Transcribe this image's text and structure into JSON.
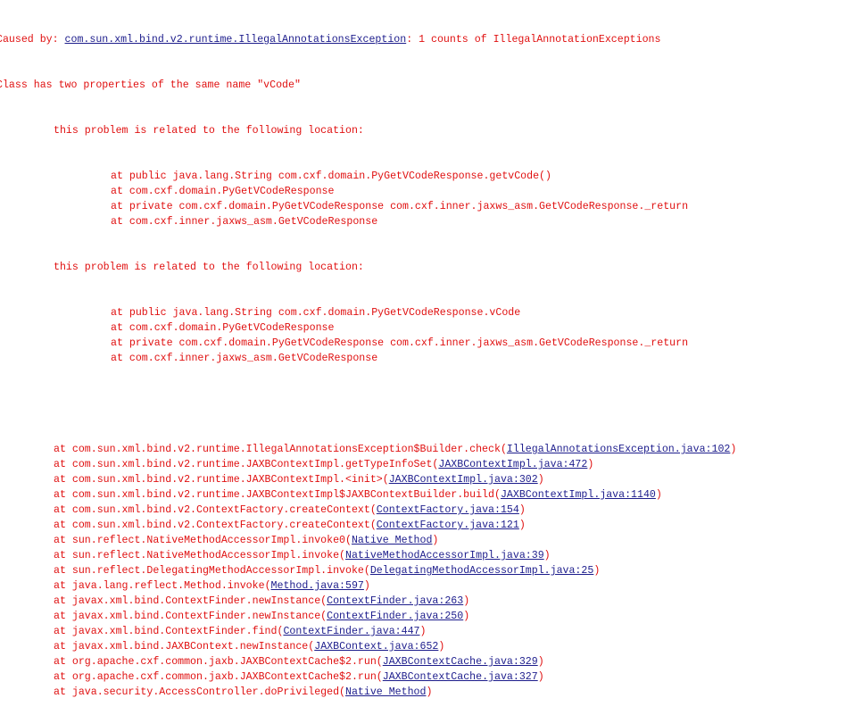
{
  "console": {
    "caused_by_prefix": "Caused by: ",
    "exception_class_link": "com.sun.xml.bind.v2.runtime.IllegalAnnotationsException",
    "caused_by_suffix": ": 1 counts of IllegalAnnotationExceptions",
    "message_line": "Class has two properties of the same name \"vCode\"",
    "problem_header_1": "this problem is related to the following location:",
    "problem_locations_1": [
      "at public java.lang.String com.cxf.domain.PyGetVCodeResponse.getvCode()",
      "at com.cxf.domain.PyGetVCodeResponse",
      "at private com.cxf.domain.PyGetVCodeResponse com.cxf.inner.jaxws_asm.GetVCodeResponse._return",
      "at com.cxf.inner.jaxws_asm.GetVCodeResponse"
    ],
    "problem_header_2": "this problem is related to the following location:",
    "problem_locations_2": [
      "at public java.lang.String com.cxf.domain.PyGetVCodeResponse.vCode",
      "at com.cxf.domain.PyGetVCodeResponse",
      "at private com.cxf.domain.PyGetVCodeResponse com.cxf.inner.jaxws_asm.GetVCodeResponse._return",
      "at com.cxf.inner.jaxws_asm.GetVCodeResponse"
    ],
    "stack_frames": [
      {
        "method": "at com.sun.xml.bind.v2.runtime.IllegalAnnotationsException$Builder.check",
        "source": "IllegalAnnotationsException.java:102"
      },
      {
        "method": "at com.sun.xml.bind.v2.runtime.JAXBContextImpl.getTypeInfoSet",
        "source": "JAXBContextImpl.java:472"
      },
      {
        "method": "at com.sun.xml.bind.v2.runtime.JAXBContextImpl.<init>",
        "source": "JAXBContextImpl.java:302"
      },
      {
        "method": "at com.sun.xml.bind.v2.runtime.JAXBContextImpl$JAXBContextBuilder.build",
        "source": "JAXBContextImpl.java:1140"
      },
      {
        "method": "at com.sun.xml.bind.v2.ContextFactory.createContext",
        "source": "ContextFactory.java:154"
      },
      {
        "method": "at com.sun.xml.bind.v2.ContextFactory.createContext",
        "source": "ContextFactory.java:121"
      },
      {
        "method": "at sun.reflect.NativeMethodAccessorImpl.invoke0",
        "source": "Native Method"
      },
      {
        "method": "at sun.reflect.NativeMethodAccessorImpl.invoke",
        "source": "NativeMethodAccessorImpl.java:39"
      },
      {
        "method": "at sun.reflect.DelegatingMethodAccessorImpl.invoke",
        "source": "DelegatingMethodAccessorImpl.java:25"
      },
      {
        "method": "at java.lang.reflect.Method.invoke",
        "source": "Method.java:597"
      },
      {
        "method": "at javax.xml.bind.ContextFinder.newInstance",
        "source": "ContextFinder.java:263"
      },
      {
        "method": "at javax.xml.bind.ContextFinder.newInstance",
        "source": "ContextFinder.java:250"
      },
      {
        "method": "at javax.xml.bind.ContextFinder.find",
        "source": "ContextFinder.java:447"
      },
      {
        "method": "at javax.xml.bind.JAXBContext.newInstance",
        "source": "JAXBContext.java:652"
      },
      {
        "method": "at org.apache.cxf.common.jaxb.JAXBContextCache$2.run",
        "source": "JAXBContextCache.java:329"
      },
      {
        "method": "at org.apache.cxf.common.jaxb.JAXBContextCache$2.run",
        "source": "JAXBContextCache.java:327"
      },
      {
        "method": "at java.security.AccessController.doPrivileged",
        "source": "Native Method"
      }
    ],
    "colors": {
      "text": "#e01010",
      "link": "#1d1d8c",
      "background": "#ffffff"
    }
  }
}
